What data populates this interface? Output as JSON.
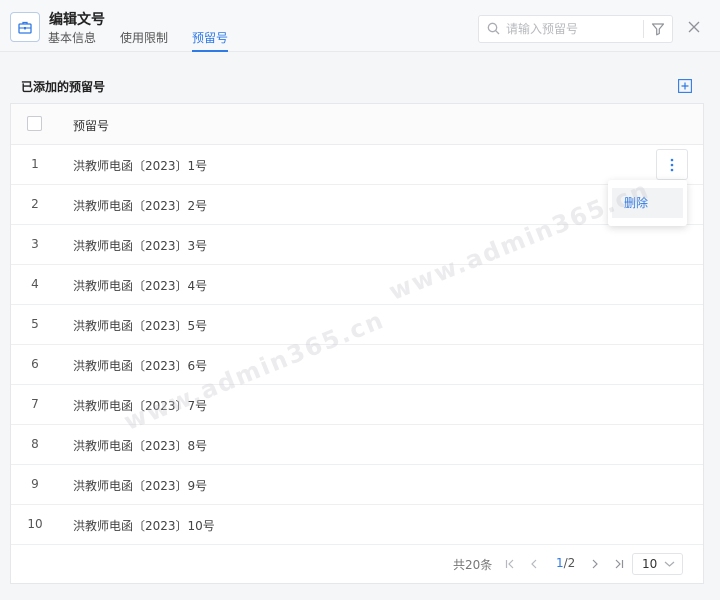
{
  "header": {
    "title": "编辑文号",
    "tabs": [
      {
        "label": "基本信息",
        "active": false
      },
      {
        "label": "使用限制",
        "active": false
      },
      {
        "label": "预留号",
        "active": true
      }
    ],
    "search": {
      "placeholder": "请输入预留号",
      "value": ""
    }
  },
  "section": {
    "title": "已添加的预留号"
  },
  "table": {
    "columns": [
      "",
      "预留号"
    ],
    "rows": [
      {
        "index": "1",
        "name": "洪教师电函〔2023〕1号"
      },
      {
        "index": "2",
        "name": "洪教师电函〔2023〕2号"
      },
      {
        "index": "3",
        "name": "洪教师电函〔2023〕3号"
      },
      {
        "index": "4",
        "name": "洪教师电函〔2023〕4号"
      },
      {
        "index": "5",
        "name": "洪教师电函〔2023〕5号"
      },
      {
        "index": "6",
        "name": "洪教师电函〔2023〕6号"
      },
      {
        "index": "7",
        "name": "洪教师电函〔2023〕7号"
      },
      {
        "index": "8",
        "name": "洪教师电函〔2023〕8号"
      },
      {
        "index": "9",
        "name": "洪教师电函〔2023〕9号"
      },
      {
        "index": "10",
        "name": "洪教师电函〔2023〕10号"
      }
    ]
  },
  "row_menu": {
    "items": [
      {
        "label": "删除"
      }
    ]
  },
  "pagination": {
    "total_text": "共20条",
    "current_page": "1",
    "total_pages": "/2",
    "page_size": "10"
  },
  "watermark": "www.admin365.cn",
  "icons": [
    "briefcase-icon",
    "search-icon",
    "filter-icon",
    "close-icon",
    "add-icon",
    "more-vertical-icon",
    "first-page-icon",
    "prev-page-icon",
    "next-page-icon",
    "last-page-icon",
    "chevron-down-icon"
  ],
  "colors": {
    "accent": "#2f7ae5",
    "background": "#f5f6f8",
    "border": "#e6e7ea"
  }
}
